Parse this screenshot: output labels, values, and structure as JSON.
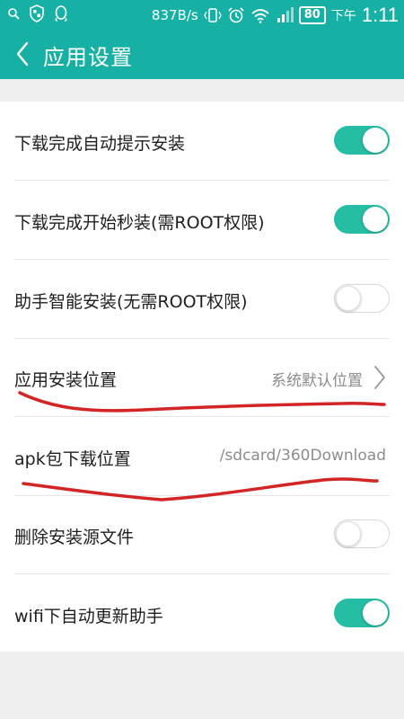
{
  "status_bar": {
    "net_speed": "837B/s",
    "battery": "80",
    "time_prefix": "下午",
    "time": "1:11"
  },
  "header": {
    "title": "应用设置",
    "back_icon": "chevron-left-icon"
  },
  "settings": [
    {
      "label": "下载完成自动提示安装",
      "control": "toggle",
      "state": "on"
    },
    {
      "label": "下载完成开始秒装(需ROOT权限)",
      "control": "toggle",
      "state": "on"
    },
    {
      "label": "助手智能安装(无需ROOT权限)",
      "control": "toggle",
      "state": "off"
    },
    {
      "label": "应用安装位置",
      "control": "select",
      "value": "系统默认位置"
    },
    {
      "label": "apk包下载位置",
      "control": "path",
      "value": "/sdcard/360Download"
    },
    {
      "label": "删除安装源文件",
      "control": "toggle",
      "state": "off"
    },
    {
      "label": "wifi下自动更新助手",
      "control": "toggle",
      "state": "on"
    }
  ],
  "colors": {
    "accent": "#17b0a5",
    "toggle_on": "#26bda5",
    "annotation": "#d32525"
  }
}
